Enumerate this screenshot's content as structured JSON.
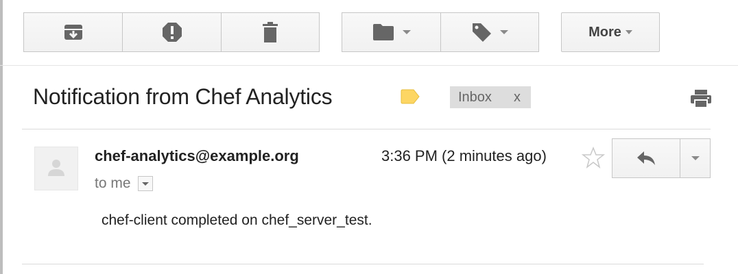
{
  "toolbar": {
    "archive_icon": "archive-icon",
    "spam_icon": "report-spam-icon",
    "delete_icon": "trash-icon",
    "move_icon": "folder-icon",
    "labels_icon": "tag-icon",
    "more_label": "More"
  },
  "message": {
    "subject": "Notification from Chef Analytics",
    "label_color": "#fdd663",
    "inbox_chip": {
      "label": "Inbox",
      "remove": "x"
    },
    "sender": "chef-analytics@example.org",
    "timestamp": "3:36 PM (2 minutes ago)",
    "recipient": "to me",
    "body": "chef-client completed on chef_server_test."
  },
  "colors": {
    "icon_gray": "#666666",
    "button_border": "#c6c6c6",
    "chip_bg": "#dddddd"
  }
}
